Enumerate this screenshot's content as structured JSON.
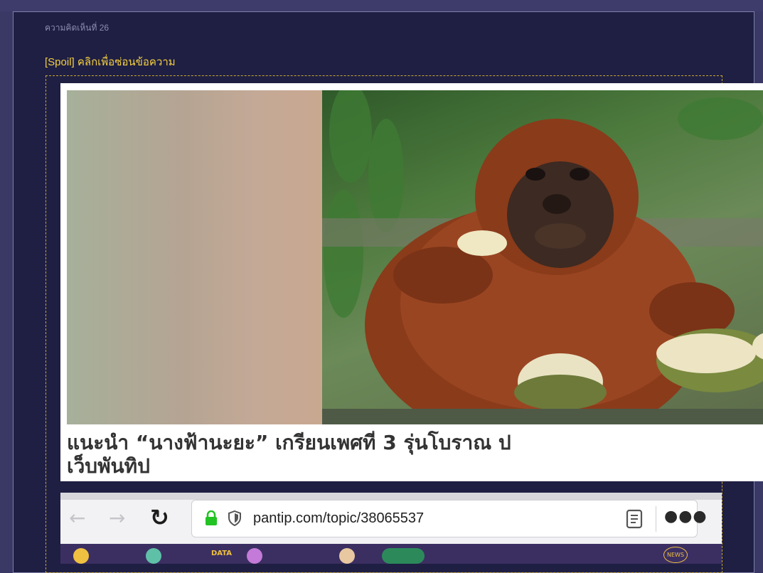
{
  "comment": {
    "number_label": "ความคิดเห็นที่ 26",
    "spoil_link": "[Spoil] คลิกเพื่อซ่อนข้อความ"
  },
  "news_card": {
    "caption": "แนะนำ “นางฟ้านะยะ” เกรียนเพศที่ 3 รุ่นโบราณ ป\nเว็บพันทิป"
  },
  "browser": {
    "url": "pantip.com/topic/38065537",
    "banner_data_label": "DATA",
    "banner_news_label": "NEWS"
  },
  "icons": [
    "back-arrow-icon",
    "forward-arrow-icon",
    "reload-icon",
    "lock-icon",
    "shield-icon",
    "reader-view-icon",
    "more-menu-icon"
  ],
  "colors": {
    "page_bg": "#3a3966",
    "comment_bg": "#1f1f44",
    "spoil_link": "#f4d03f",
    "lock_green": "#22c322"
  }
}
